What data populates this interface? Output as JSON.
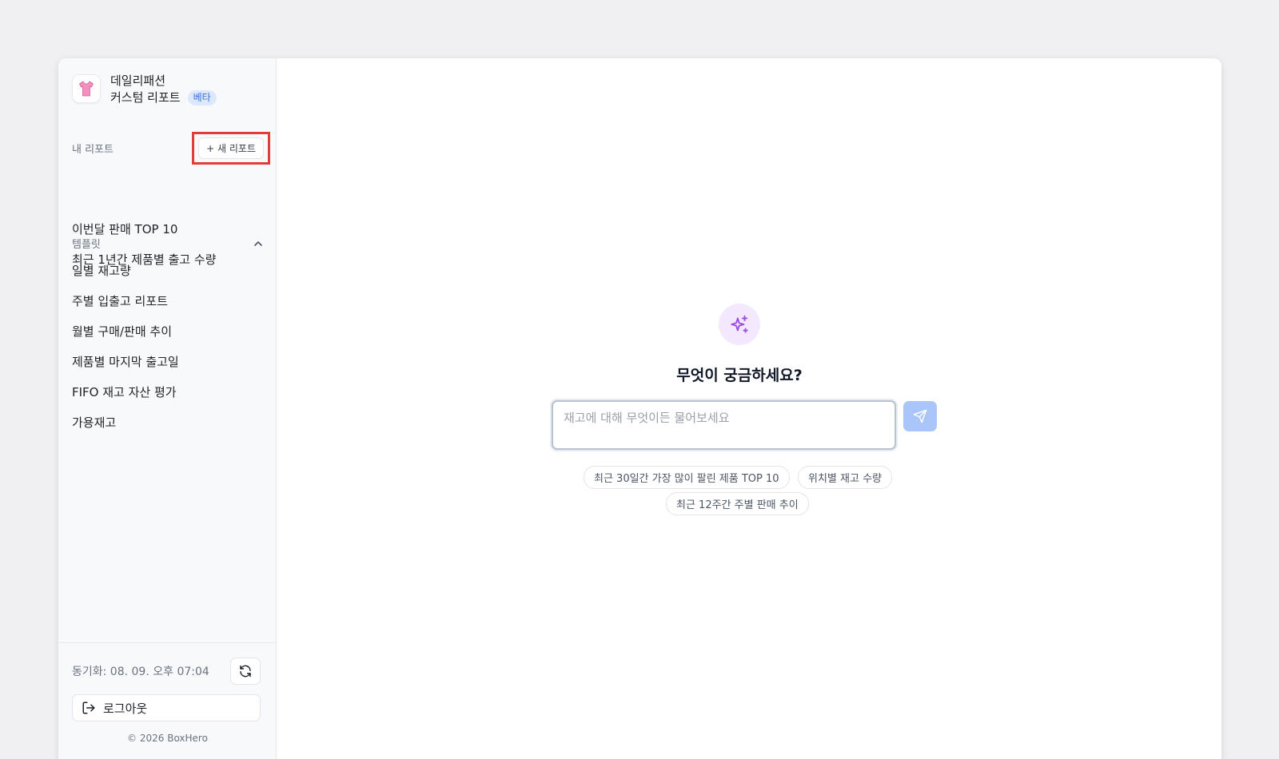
{
  "brand": {
    "name": "데일리패션",
    "subtitle": "커스텀 리포트",
    "badge": "베타",
    "logo_icon": "tshirt-icon"
  },
  "my_reports": {
    "label": "내 리포트",
    "new_button_label": "+ 새 리포트",
    "items": [
      {
        "label": "이번달 판매 TOP 10"
      },
      {
        "label": "최근 1년간 제품별 출고 수량"
      }
    ]
  },
  "templates": {
    "label": "템플릿",
    "toggle_icon": "chevron-up-icon",
    "items": [
      {
        "label": "일별 재고량"
      },
      {
        "label": "주별 입출고 리포트"
      },
      {
        "label": "월별 구매/판매 추이"
      },
      {
        "label": "제품별 마지막 출고일"
      },
      {
        "label": "FIFO 재고 자산 평가"
      },
      {
        "label": "가용재고"
      }
    ]
  },
  "footer": {
    "sync_text": "동기화: 08. 09. 오후 07:04",
    "logout_label": "로그아웃",
    "copyright": "© 2026 BoxHero"
  },
  "main": {
    "icon": "sparkles-icon",
    "headline": "무엇이 궁금하세요?",
    "input_placeholder": "재고에 대해 무엇이든 물어보세요",
    "input_value": "",
    "suggestions": [
      {
        "label": "최근 30일간 가장 많이 팔린 제품 TOP 10"
      },
      {
        "label": "위치별 재고 수량"
      },
      {
        "label": "최근 12주간 주별 판매 추이"
      }
    ]
  },
  "colors": {
    "accent_highlight": "#e23b3b",
    "send_button": "#a9c5f9",
    "sparkle_bg": "#f3e8fd",
    "sparkle": "#9b4de0",
    "badge_bg": "#dde9fb",
    "badge_text": "#3a6fd8"
  }
}
